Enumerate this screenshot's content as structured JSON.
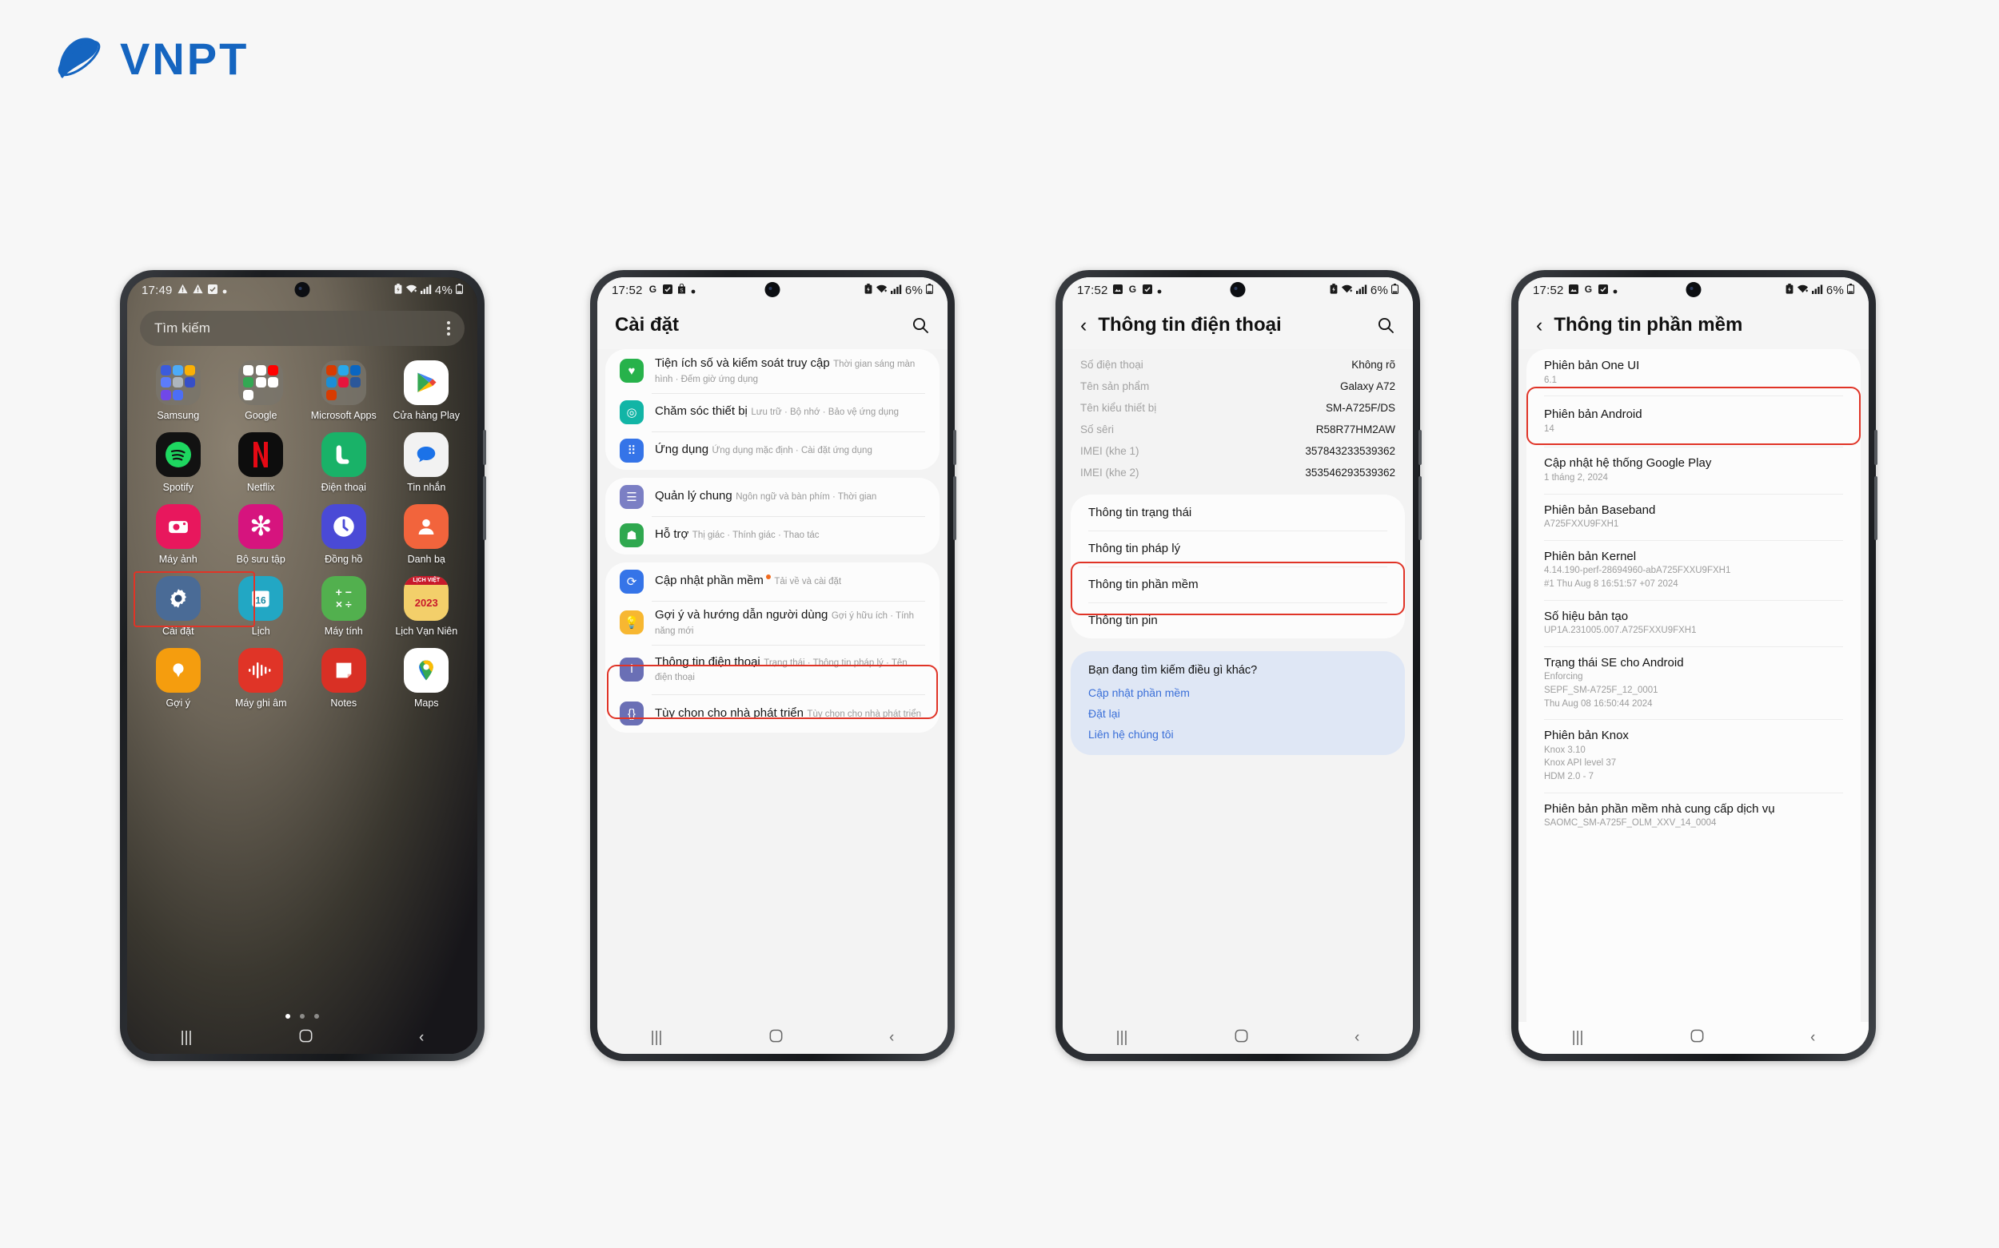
{
  "brand": {
    "name": "VNPT",
    "color": "#1565c0"
  },
  "phone1": {
    "status": {
      "time": "17:49",
      "battery": "4%",
      "icons": [
        "warning-icon",
        "warning-icon",
        "checkbox-icon",
        "dot-icon"
      ],
      "right_icons": [
        "battery-saver-icon",
        "wifi-icon",
        "signal-icon"
      ]
    },
    "search": {
      "placeholder": "Tìm kiếm",
      "menu": "overflow-menu"
    },
    "rows": [
      [
        {
          "label": "Samsung",
          "icon": "folder-icon",
          "type": "folder"
        },
        {
          "label": "Google",
          "icon": "folder-icon",
          "type": "folder"
        },
        {
          "label": "Microsoft Apps",
          "icon": "folder-icon",
          "type": "folder"
        },
        {
          "label": "Cửa hàng Play",
          "icon": "play-store-icon",
          "type": "app",
          "color": "#ffffff",
          "glyph": "▶"
        }
      ],
      [
        {
          "label": "Spotify",
          "icon": "spotify-icon",
          "type": "app",
          "color": "#121212",
          "glyph": "♫"
        },
        {
          "label": "Netflix",
          "icon": "netflix-icon",
          "type": "app",
          "color": "#0d0d0d",
          "glyph": "N"
        },
        {
          "label": "Điện thoại",
          "icon": "phone-icon",
          "type": "app",
          "color": "#19b268",
          "glyph": "✆"
        },
        {
          "label": "Tin nhắn",
          "icon": "messages-icon",
          "type": "app",
          "color": "#f2f2f2",
          "glyph": "💬"
        }
      ],
      [
        {
          "label": "Máy ảnh",
          "icon": "camera-icon",
          "type": "app",
          "color": "#e8175d",
          "glyph": "◉"
        },
        {
          "label": "Bộ sưu tập",
          "icon": "gallery-icon",
          "type": "app",
          "color": "#d6147e",
          "glyph": "✿"
        },
        {
          "label": "Đồng hồ",
          "icon": "clock-icon",
          "type": "app",
          "color": "#4a4ad6",
          "glyph": "◷"
        },
        {
          "label": "Danh bạ",
          "icon": "contacts-icon",
          "type": "app",
          "color": "#f2643c",
          "glyph": "👤"
        }
      ],
      [
        {
          "label": "Cài đặt",
          "icon": "settings-gear-icon",
          "type": "app",
          "color": "#4a6b96",
          "glyph": "⚙"
        },
        {
          "label": "Lịch",
          "icon": "calendar-icon",
          "type": "app",
          "color": "#22a7c4",
          "glyph": "16"
        },
        {
          "label": "Máy tính",
          "icon": "calculator-icon",
          "type": "app",
          "color": "#52b04e",
          "glyph": "+−×÷"
        },
        {
          "label": "Lịch Vạn Niên",
          "icon": "lich-van-nien-icon",
          "type": "app",
          "color": "#c8192b",
          "glyph": "2023"
        }
      ],
      [
        {
          "label": "Gợi ý",
          "icon": "tips-bulb-icon",
          "type": "app",
          "color": "#f59d0e",
          "glyph": "💡"
        },
        {
          "label": "Máy ghi âm",
          "icon": "voice-recorder-icon",
          "type": "app",
          "color": "#e03427",
          "glyph": "ılıl"
        },
        {
          "label": "Notes",
          "icon": "notes-icon",
          "type": "app",
          "color": "#d93025",
          "glyph": "▤"
        },
        {
          "label": "Maps",
          "icon": "maps-icon",
          "type": "app",
          "color": "#ffffff",
          "glyph": "📍"
        }
      ]
    ],
    "page_dots": 3,
    "active_dot": 1,
    "navbar": {
      "recents": "recents-icon",
      "home": "home-icon",
      "back": "back-icon"
    },
    "highlight_label": "settings-app-highlight"
  },
  "phone2": {
    "status": {
      "time": "17:52",
      "battery": "6%"
    },
    "title": "Cài đặt",
    "search_icon": "search-icon",
    "groups": [
      {
        "items": [
          {
            "title": "Tiện ích số và kiểm soát truy cập",
            "sub": "Thời gian sáng màn hình  ·  Đếm giờ ứng dụng",
            "icon": "digital-wellbeing-icon",
            "color": "#27b24b"
          },
          {
            "title": "Chăm sóc thiết bị",
            "sub": "Lưu trữ  ·  Bộ nhớ  ·  Bảo vệ ứng dụng",
            "icon": "device-care-icon",
            "color": "#12b5a6"
          },
          {
            "title": "Ứng dụng",
            "sub": "Ứng dụng mặc định  ·  Cài đặt ứng dụng",
            "icon": "apps-icon",
            "color": "#3574e8"
          }
        ]
      },
      {
        "items": [
          {
            "title": "Quản lý chung",
            "sub": "Ngôn ngữ và bàn phím  ·  Thời gian",
            "icon": "general-management-icon",
            "color": "#7b7fc4"
          },
          {
            "title": "Hỗ trợ",
            "sub": "Thị giác  ·  Thính giác  ·  Thao tác",
            "icon": "accessibility-icon",
            "color": "#2fa84f"
          }
        ]
      },
      {
        "items": [
          {
            "title": "Cập nhật phần mềm",
            "sub": "Tải về và cài đặt",
            "icon": "software-update-icon",
            "color": "#3574e8",
            "badge": true
          },
          {
            "title": "Gợi ý và hướng dẫn người dùng",
            "sub": "Gợi ý hữu ích  ·  Tính năng mới",
            "icon": "tips-icon",
            "color": "#f7b731"
          },
          {
            "title": "Thông tin điện thoại",
            "sub": "Trạng thái  ·  Thông tin pháp lý  ·  Tên điện thoại",
            "icon": "about-phone-icon",
            "color": "#6a6fb5",
            "highlighted": true
          },
          {
            "title": "Tùy chọn cho nhà phát triển",
            "sub": "Tùy chọn cho nhà phát triển",
            "icon": "developer-options-icon",
            "color": "#6a6fb5"
          }
        ]
      }
    ],
    "navbar": {
      "recents": "recents-icon",
      "home": "home-icon",
      "back": "back-icon"
    }
  },
  "phone3": {
    "status": {
      "time": "17:52",
      "battery": "6%"
    },
    "title": "Thông tin điện thoại",
    "back_icon": "back-chevron-icon",
    "search_icon": "search-icon",
    "info": [
      {
        "key": "Số điện thoại",
        "value": "Không rõ"
      },
      {
        "key": "Tên sản phẩm",
        "value": "Galaxy A72"
      },
      {
        "key": "Tên kiểu thiết bị",
        "value": "SM-A725F/DS"
      },
      {
        "key": "Số sêri",
        "value": "R58R77HM2AW"
      },
      {
        "key": "IMEI (khe 1)",
        "value": "357843233539362"
      },
      {
        "key": "IMEI (khe 2)",
        "value": "353546293539362"
      }
    ],
    "links": [
      {
        "label": "Thông tin trạng thái"
      },
      {
        "label": "Thông tin pháp lý"
      },
      {
        "label": "Thông tin phần mềm",
        "highlighted": true
      },
      {
        "label": "Thông tin pin"
      }
    ],
    "help": {
      "heading": "Bạn đang tìm kiếm điều gì khác?",
      "links": [
        "Cập nhật phần mềm",
        "Đặt lại",
        "Liên hệ chúng tôi"
      ]
    },
    "navbar": {
      "recents": "recents-icon",
      "home": "home-icon",
      "back": "back-icon"
    }
  },
  "phone4": {
    "status": {
      "time": "17:52",
      "battery": "6%"
    },
    "title": "Thông tin phần mềm",
    "back_icon": "back-chevron-icon",
    "items": [
      {
        "title": "Phiên bản One UI",
        "lines": [
          "6.1"
        ]
      },
      {
        "title": "Phiên bản Android",
        "lines": [
          "14"
        ],
        "highlighted": true
      },
      {
        "title": "Cập nhật hệ thống Google Play",
        "lines": [
          "1 tháng 2, 2024"
        ]
      },
      {
        "title": "Phiên bản Baseband",
        "lines": [
          "A725FXXU9FXH1"
        ]
      },
      {
        "title": "Phiên bản Kernel",
        "lines": [
          "4.14.190-perf-28694960-abA725FXXU9FXH1",
          "#1 Thu Aug 8 16:51:57 +07 2024"
        ]
      },
      {
        "title": "Số hiệu bản tạo",
        "lines": [
          "UP1A.231005.007.A725FXXU9FXH1"
        ]
      },
      {
        "title": "Trạng thái SE cho Android",
        "lines": [
          "Enforcing",
          "SEPF_SM-A725F_12_0001",
          "Thu Aug 08 16:50:44 2024"
        ]
      },
      {
        "title": "Phiên bản Knox",
        "lines": [
          "Knox 3.10",
          "Knox API level 37",
          "HDM 2.0 - 7"
        ]
      },
      {
        "title": "Phiên bản phần mềm nhà cung cấp dịch vụ",
        "lines": [
          "SAOMC_SM-A725F_OLM_XXV_14_0004"
        ]
      }
    ],
    "navbar": {
      "recents": "recents-icon",
      "home": "home-icon",
      "back": "back-icon"
    }
  }
}
